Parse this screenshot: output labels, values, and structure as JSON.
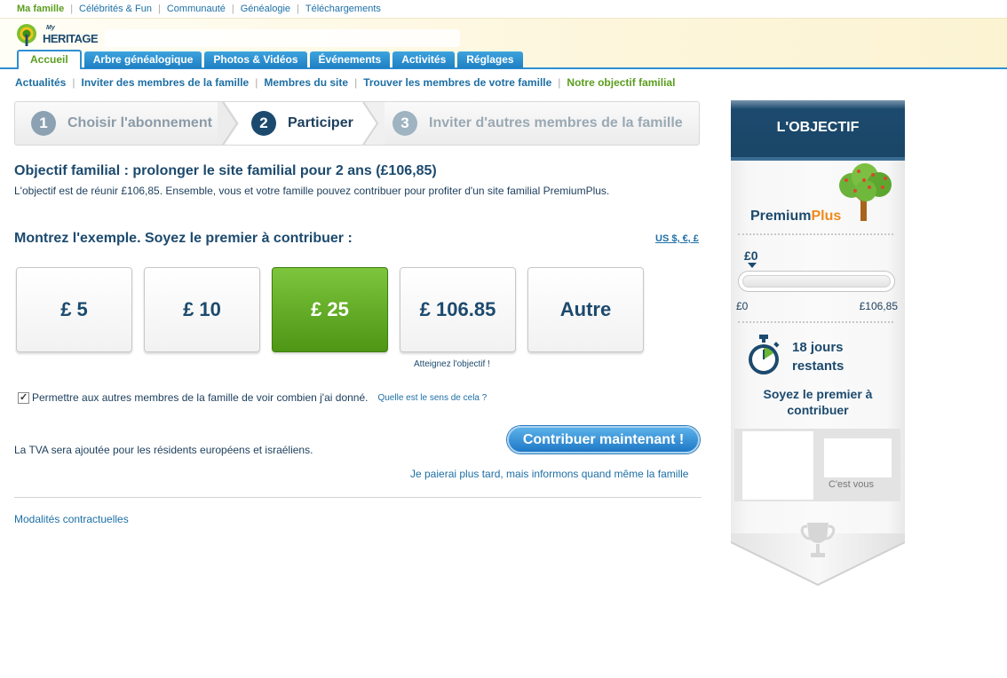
{
  "top_links": [
    "Ma famille",
    "Célébrités & Fun",
    "Communauté",
    "Généalogie",
    "Téléchargements"
  ],
  "logo": {
    "my": "My",
    "text": "HERITAGE"
  },
  "tabs": [
    "Accueil",
    "Arbre généalogique",
    "Photos & Vidéos",
    "Événements",
    "Activités",
    "Réglages"
  ],
  "subnav": [
    "Actualités",
    "Inviter des membres de la famille",
    "Membres du site",
    "Trouver les membres de votre famille",
    "Notre objectif familial"
  ],
  "steps": [
    {
      "num": "1",
      "label": "Choisir l'abonnement"
    },
    {
      "num": "2",
      "label": "Participer"
    },
    {
      "num": "3",
      "label": "Inviter d'autres membres de la famille"
    }
  ],
  "goal": {
    "title": "Objectif familial : prolonger le site familial pour 2 ans (£106,85)",
    "description": "L'objectif est de réunir £106,85. Ensemble, vous et votre famille pouvez contribuer pour profiter d'un site familial PremiumPlus."
  },
  "lead": "Montrez l'exemple. Soyez le premier à contribuer :",
  "currency_link": "US $, €, £",
  "amounts": [
    "£ 5",
    "£ 10",
    "£ 25",
    "£ 106.85",
    "Autre"
  ],
  "selected_amount_index": 2,
  "reach_goal": "Atteignez l'objectif !",
  "permission": {
    "checked": true,
    "label": "Permettre aux autres membres de la famille de voir combien j'ai donné.",
    "help_link": "Quelle est le sens de cela ?"
  },
  "vat_note": "La TVA sera ajoutée pour les résidents européens et israéliens.",
  "contribute_button": "Contribuer maintenant !",
  "later_link": "Je paierai plus tard, mais informons quand même la famille",
  "terms_link": "Modalités contractuelles",
  "panel": {
    "title": "L'OBJECTIF",
    "brand_a": "Premium",
    "brand_b": "Plus",
    "current": "£0",
    "progress_fraction": 0,
    "min": "£0",
    "max": "£106,85",
    "days_line1": "18 jours",
    "days_line2": "restants",
    "first_line1": "Soyez le premier à",
    "first_line2": "contribuer",
    "cest_vous": "C'est vous"
  },
  "colors": {
    "brand_blue": "#1c4a6e",
    "link_blue": "#1d6fa5",
    "green": "#5a9e1e",
    "orange": "#f08a1c"
  }
}
